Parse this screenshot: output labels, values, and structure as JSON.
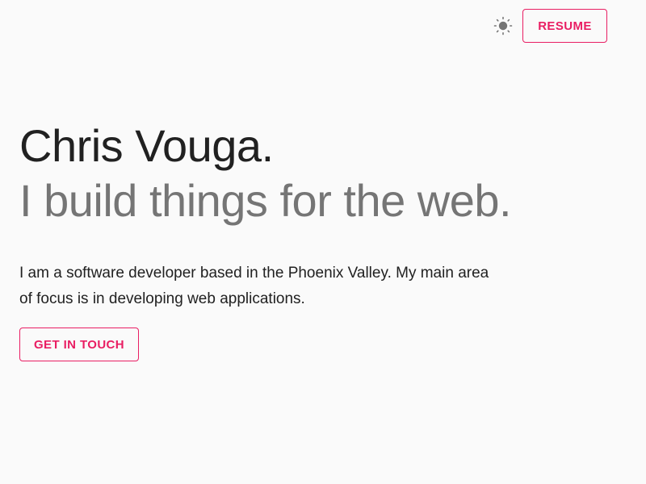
{
  "header": {
    "theme_icon": "sun-icon",
    "resume_label": "RESUME"
  },
  "hero": {
    "name": "Chris Vouga.",
    "tagline": "I build things for the web.",
    "description": "I am a software developer based in the Phoenix Valley. My main area of focus is in developing web applications.",
    "contact_label": "GET IN TOUCH"
  },
  "colors": {
    "accent": "#e91e63",
    "background": "#fafafa",
    "primary_text": "#212121",
    "secondary_text": "#757575",
    "icon": "#757575"
  }
}
